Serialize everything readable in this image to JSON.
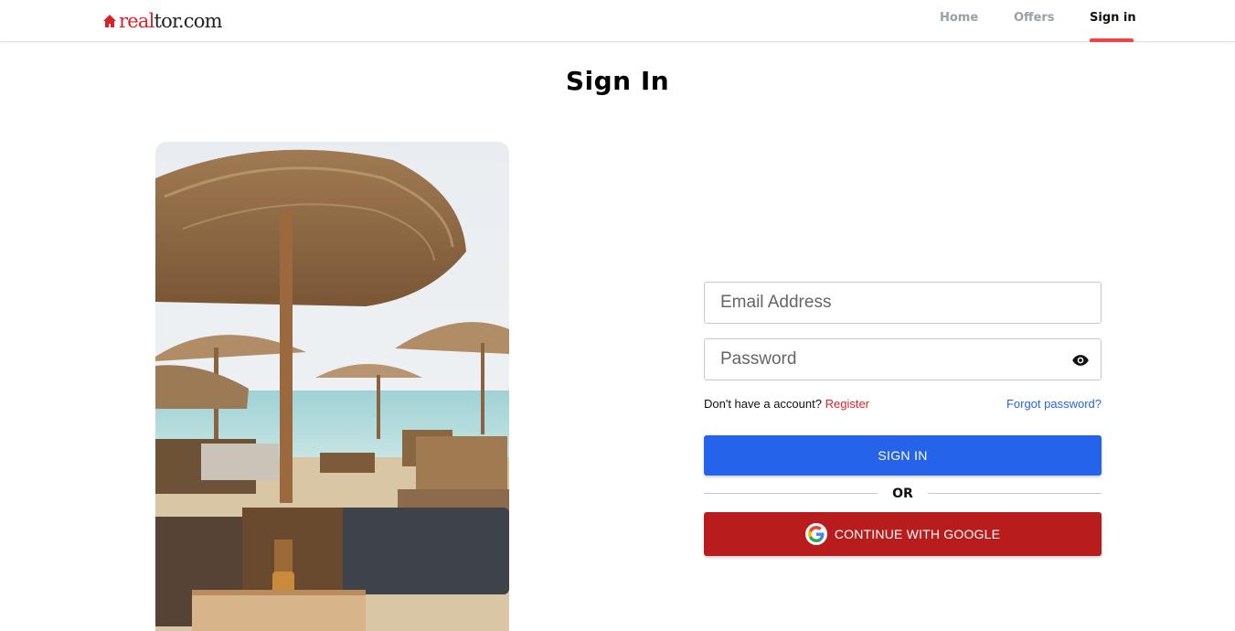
{
  "brand": {
    "logo_real": "real",
    "logo_tor": "tor.com",
    "accent_color": "#d92228"
  },
  "nav": {
    "items": [
      {
        "label": "Home",
        "active": false
      },
      {
        "label": "Offers",
        "active": false
      },
      {
        "label": "Sign in",
        "active": true
      }
    ],
    "active_underline_color": "#ef4444"
  },
  "page": {
    "title": "Sign In"
  },
  "hero_image": {
    "alt": "",
    "icon": "beach-umbrellas-photo"
  },
  "form": {
    "email": {
      "placeholder": "Email Address",
      "value": ""
    },
    "password": {
      "placeholder": "Password",
      "value": "",
      "toggle_icon": "eye-icon"
    },
    "no_account_text": "Don't have a account?",
    "register_label": "Register",
    "forgot_label": "Forgot password?",
    "signin_label": "SIGN IN",
    "signin_color": "#2563eb",
    "or_label": "OR",
    "google_label": "CONTINUE WITH GOOGLE",
    "google_color": "#b91c1c",
    "google_icon": "google-icon"
  }
}
